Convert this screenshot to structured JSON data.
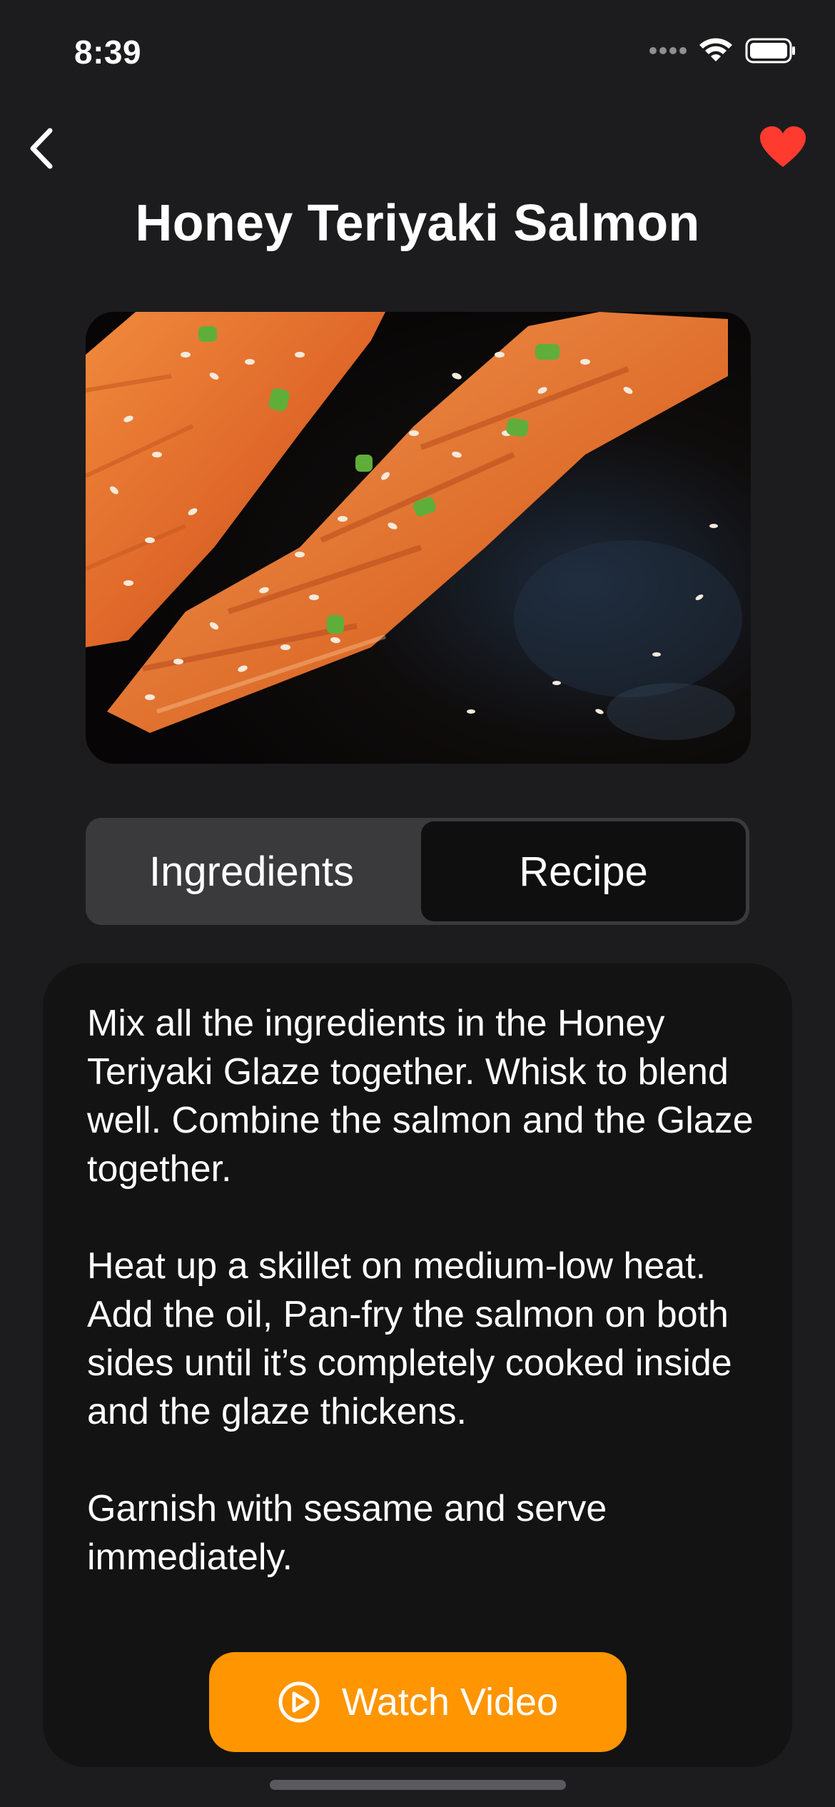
{
  "status_bar": {
    "time": "8:39",
    "icons": [
      "cellular-icon",
      "wifi-icon",
      "battery-icon"
    ]
  },
  "nav": {
    "back_icon": "chevron-left-icon",
    "favorite_icon": "heart-icon",
    "favorite_color": "#ff3b30"
  },
  "recipe": {
    "title": "Honey Teriyaki Salmon"
  },
  "tabs": [
    {
      "label": "Ingredients",
      "selected": false
    },
    {
      "label": "Recipe",
      "selected": true
    }
  ],
  "instructions": [
    "Mix all the ingredients in the Honey Teriyaki Glaze together. Whisk to blend well. Combine the salmon and the Glaze together.",
    "Heat up a skillet on medium-low heat. Add the oil, Pan-fry the salmon on both sides until it’s completely cooked inside and the glaze thickens.",
    "Garnish with sesame and serve immediately."
  ],
  "watch_button": {
    "label": "Watch Video",
    "icon": "play-circle-icon",
    "color": "#ff9500"
  }
}
